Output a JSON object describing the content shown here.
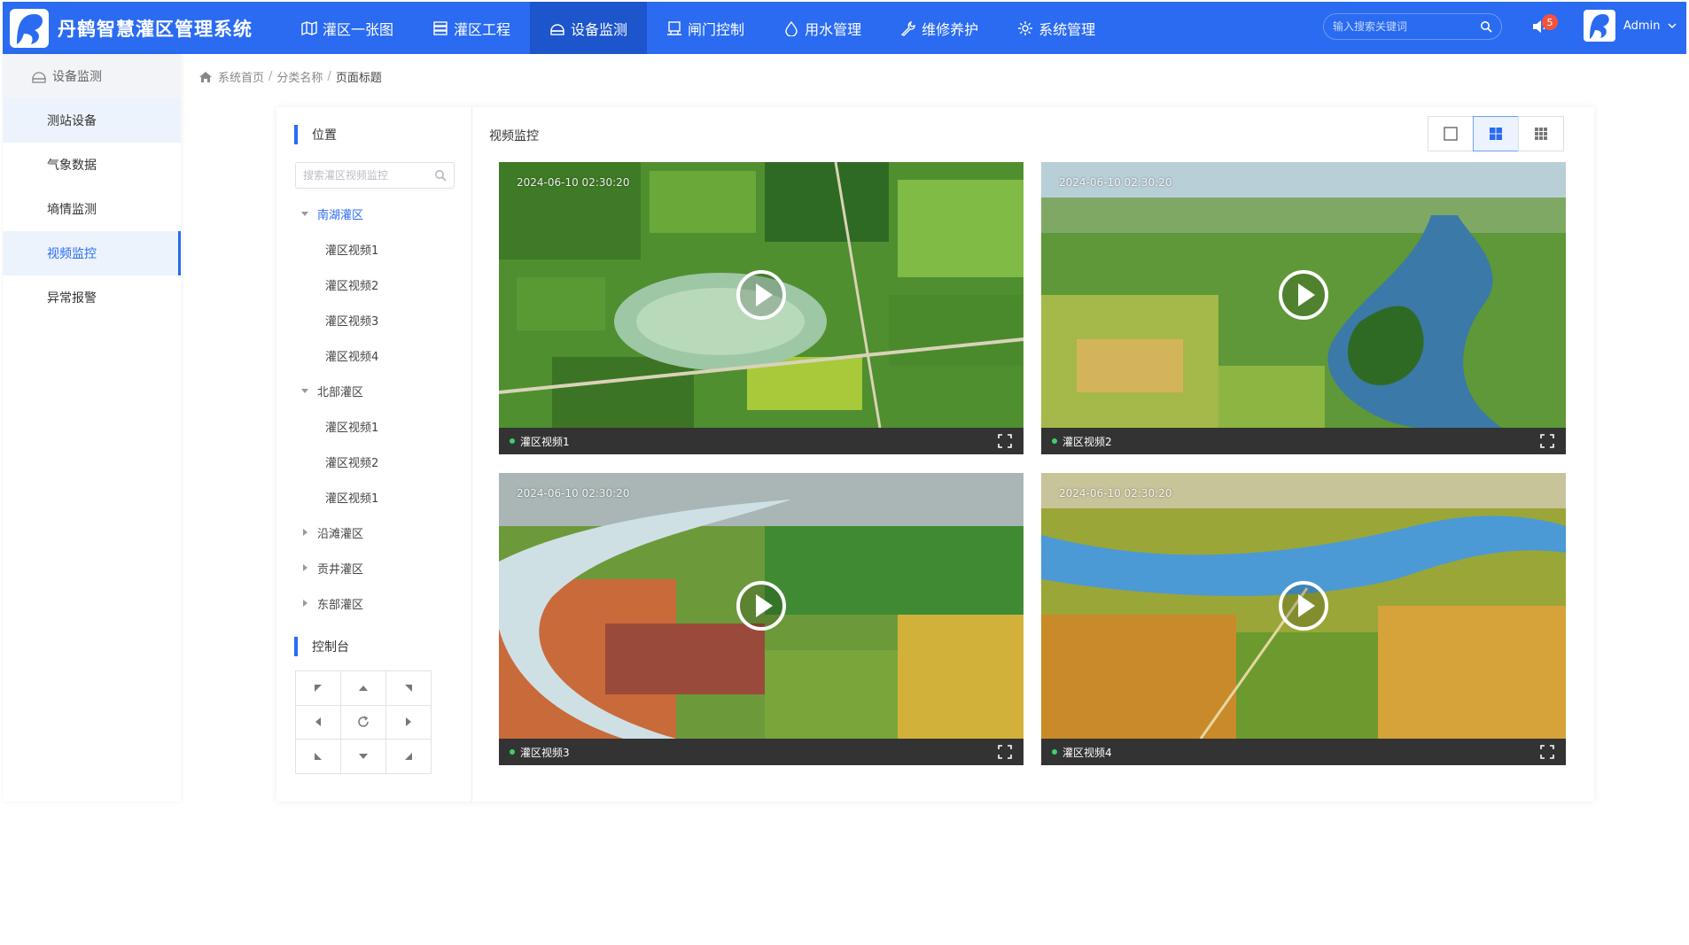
{
  "app": {
    "title": "丹鹤智慧灌区管理系统"
  },
  "nav": [
    {
      "label": "灌区一张图",
      "icon": "map-icon"
    },
    {
      "label": "灌区工程",
      "icon": "server-icon"
    },
    {
      "label": "设备监测",
      "icon": "monitor-icon",
      "active": true
    },
    {
      "label": "闸门控制",
      "icon": "gate-icon"
    },
    {
      "label": "用水管理",
      "icon": "water-drop-icon"
    },
    {
      "label": "维修养护",
      "icon": "wrench-icon"
    },
    {
      "label": "系统管理",
      "icon": "gear-icon"
    }
  ],
  "header": {
    "search_placeholder": "输入搜索关键词",
    "notification_count": "5",
    "user_name": "Admin"
  },
  "sidebar": {
    "section": "设备监测",
    "items": [
      {
        "label": "测站设备"
      },
      {
        "label": "气象数据"
      },
      {
        "label": "墒情监测"
      },
      {
        "label": "视频监控",
        "active": true
      },
      {
        "label": "异常报警"
      }
    ]
  },
  "breadcrumb": {
    "home": "系统首页",
    "category": "分类名称",
    "current": "页面标题"
  },
  "tree": {
    "title": "位置",
    "search_placeholder": "搜索灌区视频监控",
    "nodes": [
      {
        "label": "南湖灌区",
        "expanded": true,
        "selected": true,
        "children": [
          "灌区视频1",
          "灌区视频2",
          "灌区视频3",
          "灌区视频4"
        ]
      },
      {
        "label": "北部灌区",
        "expanded": true,
        "children": [
          "灌区视频1",
          "灌区视频2",
          "灌区视频1"
        ]
      },
      {
        "label": "沿滩灌区",
        "expanded": false
      },
      {
        "label": "贡井灌区",
        "expanded": false
      },
      {
        "label": "东部灌区",
        "expanded": false
      }
    ]
  },
  "console": {
    "title": "控制台"
  },
  "video": {
    "title": "视频监控",
    "layout_options": [
      "single",
      "quad",
      "nine"
    ],
    "active_layout": "quad",
    "tiles": [
      {
        "timestamp": "2024-06-10 02:30:20",
        "name": "灌区视频1",
        "status": "online"
      },
      {
        "timestamp": "2024-06-10 02:30:20",
        "name": "灌区视频2",
        "status": "online"
      },
      {
        "timestamp": "2024-06-10 02:30:20",
        "name": "灌区视频3",
        "status": "online"
      },
      {
        "timestamp": "2024-06-10 02:30:20",
        "name": "灌区视频4",
        "status": "online"
      }
    ]
  },
  "colors": {
    "primary": "#2a6bf2",
    "nav_active": "#1c55cc",
    "online": "#3ad16a",
    "badge": "#f5533d"
  }
}
